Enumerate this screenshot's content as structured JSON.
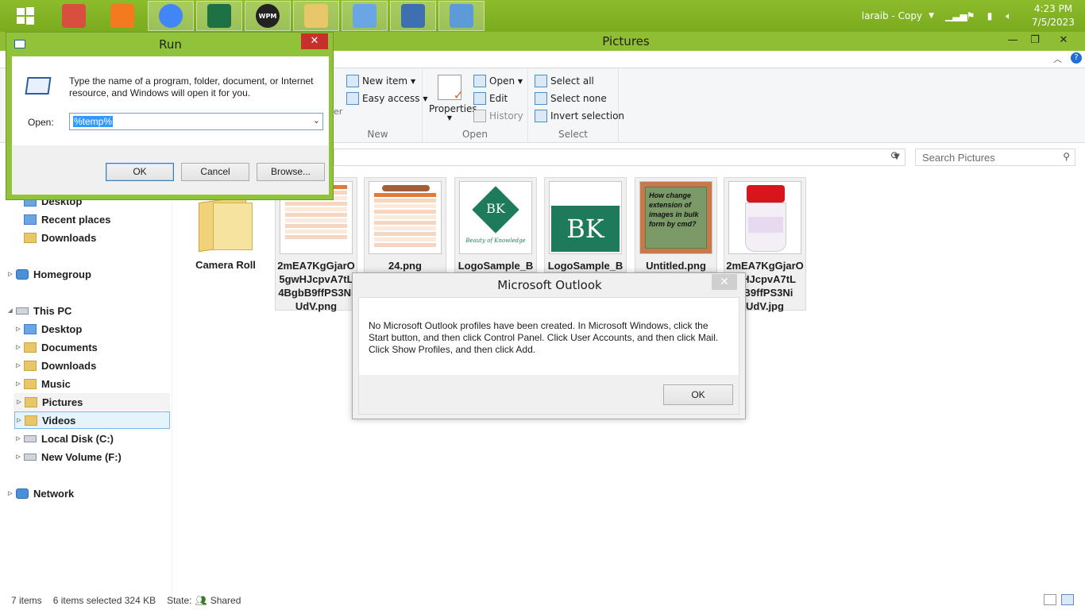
{
  "taskbar": {
    "user": "laraib - Copy",
    "time": "4:23 PM",
    "date": "7/5/2023",
    "apps": [
      {
        "name": "start-icon",
        "color": "#ffffff"
      },
      {
        "name": "paint-tool-icon",
        "color": "#d94f3d"
      },
      {
        "name": "uc-browser-icon",
        "color": "#f47a20"
      },
      {
        "name": "chrome-icon",
        "color": "#4285f4"
      },
      {
        "name": "excel-icon",
        "color": "#1e7145"
      },
      {
        "name": "wpm-icon",
        "label": "WPM",
        "color": "#222222"
      },
      {
        "name": "file-explorer-icon",
        "color": "#e8c66a"
      },
      {
        "name": "paint-palette-icon",
        "color": "#6aa6e3"
      },
      {
        "name": "window-app-icon",
        "color": "#3e6fb0"
      },
      {
        "name": "run-app-icon",
        "color": "#5d9bd8"
      }
    ]
  },
  "explorer": {
    "title": "Pictures",
    "ribbon": {
      "new_group": {
        "new_item": "New item",
        "easy_access": "Easy access",
        "label": "New",
        "partial_text": "er"
      },
      "open_group": {
        "properties": "Properties",
        "open": "Open",
        "edit": "Edit",
        "history": "History",
        "label": "Open"
      },
      "select_group": {
        "select_all": "Select all",
        "select_none": "Select none",
        "invert": "Invert selection",
        "label": "Select"
      }
    },
    "search_placeholder": "Search Pictures",
    "nav": [
      {
        "label": "Desktop",
        "icon": "blue",
        "level": 1,
        "arrow": ""
      },
      {
        "label": "Recent places",
        "icon": "blue",
        "level": 1,
        "arrow": ""
      },
      {
        "label": "Downloads",
        "icon": "folder",
        "level": 1,
        "arrow": ""
      },
      {
        "label": "Homegroup",
        "icon": "net",
        "level": 0,
        "arrow": "▷"
      },
      {
        "label": "This PC",
        "icon": "drive",
        "level": 0,
        "arrow": "◢"
      },
      {
        "label": "Desktop",
        "icon": "blue",
        "level": 1,
        "arrow": "▷"
      },
      {
        "label": "Documents",
        "icon": "folder",
        "level": 1,
        "arrow": "▷"
      },
      {
        "label": "Downloads",
        "icon": "folder",
        "level": 1,
        "arrow": "▷"
      },
      {
        "label": "Music",
        "icon": "folder",
        "level": 1,
        "arrow": "▷"
      },
      {
        "label": "Pictures",
        "icon": "folder",
        "level": 1,
        "arrow": "▷"
      },
      {
        "label": "Videos",
        "icon": "folder",
        "level": 1,
        "arrow": "▷"
      },
      {
        "label": "Local Disk (C:)",
        "icon": "drive",
        "level": 1,
        "arrow": "▷"
      },
      {
        "label": "New Volume (F:)",
        "icon": "drive",
        "level": 1,
        "arrow": "▷"
      },
      {
        "label": "Network",
        "icon": "net",
        "level": 0,
        "arrow": "▷"
      }
    ],
    "files": [
      {
        "name": "Camera Roll",
        "type": "folder"
      },
      {
        "name": "2mEA7KgGjarO5gwHJcpvA7tL4BgbB9ffPS3NiUdV.png",
        "display": "2mEA7KgGjarO\n5gwHJcpvA7tL\n4BgbB9ffPS3Ni\nUdV.png",
        "type": "table-orange"
      },
      {
        "name": "24.png",
        "type": "table-orange2"
      },
      {
        "name": "LogoSample_B",
        "display": "LogoSample_B",
        "type": "bk-logo",
        "logo": "BK",
        "logo_sub": "Beauty of Knowledge"
      },
      {
        "name": "LogoSample_B",
        "display": "LogoSample_B",
        "type": "bk-green",
        "logo": "BK"
      },
      {
        "name": "Untitled.png",
        "type": "text-card",
        "card_text": "How change extension of images in bulk form by cmd?"
      },
      {
        "name": "2mEA7KgGjarO5gwHJcpvA7tLbB9ffPS3NiUdV.jpg",
        "display": "2mEA7KgGjarO\nwHJcpvA7tL\nbB9ffPS3Ni\nUdV.jpg",
        "type": "jar"
      }
    ],
    "status": {
      "items": "7 items",
      "selected": "6 items selected  324 KB",
      "state": "State:",
      "shared": "Shared"
    }
  },
  "run_dialog": {
    "title": "Run",
    "description": "Type the name of a program, folder, document, or Internet resource, and Windows will open it for you.",
    "open_label": "Open:",
    "open_value": "%temp%",
    "ok": "OK",
    "cancel": "Cancel",
    "browse": "Browse..."
  },
  "outlook_dialog": {
    "title": "Microsoft Outlook",
    "message": "No Microsoft Outlook profiles have been created. In Microsoft Windows, click the Start button, and then click Control Panel. Click User Accounts, and then click Mail. Click Show Profiles, and then click Add.",
    "ok": "OK"
  }
}
